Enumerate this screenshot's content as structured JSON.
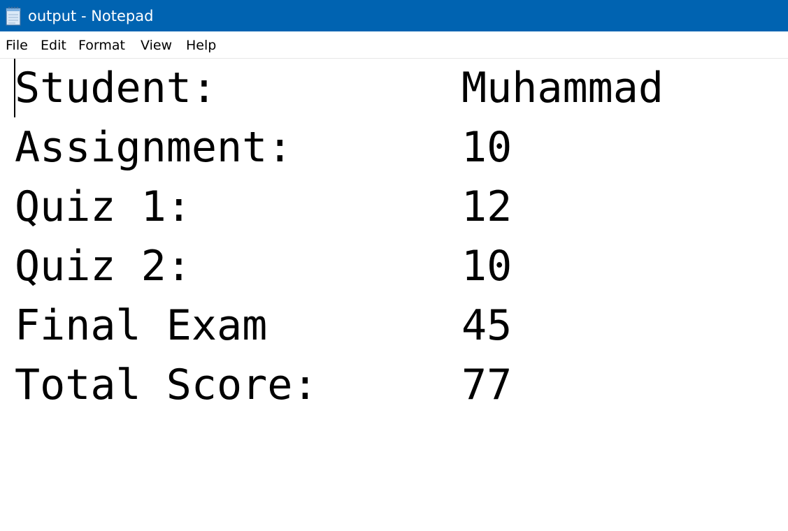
{
  "window": {
    "title": "output - Notepad",
    "icon": "notepad-icon",
    "titlebar_color": "#0063b1"
  },
  "menu": {
    "items": [
      {
        "label": "File"
      },
      {
        "label": "Edit"
      },
      {
        "label": "Format"
      },
      {
        "label": "View"
      },
      {
        "label": "Help"
      }
    ]
  },
  "document": {
    "lines": [
      {
        "label": "Student:",
        "value": "Muhammad"
      },
      {
        "label": "Assignment:",
        "value": "10"
      },
      {
        "label": "Quiz 1:",
        "value": "12"
      },
      {
        "label": "Quiz 2:",
        "value": "10"
      },
      {
        "label": "Final Exam",
        "value": "45"
      },
      {
        "label": "Total Score:",
        "value": "77"
      }
    ]
  }
}
